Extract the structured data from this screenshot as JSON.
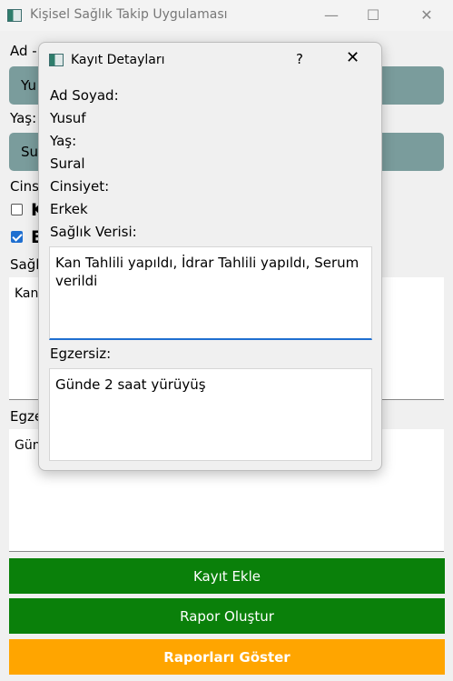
{
  "window": {
    "title": "Kişisel Sağlık Takip Uygulaması",
    "minimize_glyph": "—",
    "maximize_glyph": "☐",
    "close_glyph": "✕"
  },
  "form": {
    "name_label": "Ad -",
    "name_value": "Yu",
    "age_label": "Yaş:",
    "surname_value": "Su",
    "gender_label": "Cinsi",
    "checkbox_1_label": "K",
    "checkbox_2_label": "E",
    "health_label": "Sağlı",
    "health_value": "Kan",
    "exercise_label": "Egze",
    "exercise_value": "Gün"
  },
  "buttons": {
    "add_record": "Kayıt Ekle",
    "create_report": "Rapor Oluştur",
    "show_reports": "Raporları Göster"
  },
  "dialog": {
    "title": "Kayıt Detayları",
    "help_glyph": "?",
    "close_glyph": "✕",
    "name_label": "Ad Soyad:",
    "name_value": "Yusuf",
    "age_label": "Yaş:",
    "age_value": "Sural",
    "gender_label": "Cinsiyet:",
    "gender_value": "Erkek",
    "health_label": "Sağlık Verisi:",
    "health_value": "Kan Tahlili yapıldı, İdrar Tahlili yapıldı, Serum verildi",
    "exercise_label": "Egzersiz:",
    "exercise_value": "Günde 2 saat yürüyüş"
  },
  "colors": {
    "field_bg": "#7a9c9c",
    "button_green": "#0a800a",
    "button_orange": "#ffa500",
    "checkbox_checked": "#1f6fd0"
  }
}
